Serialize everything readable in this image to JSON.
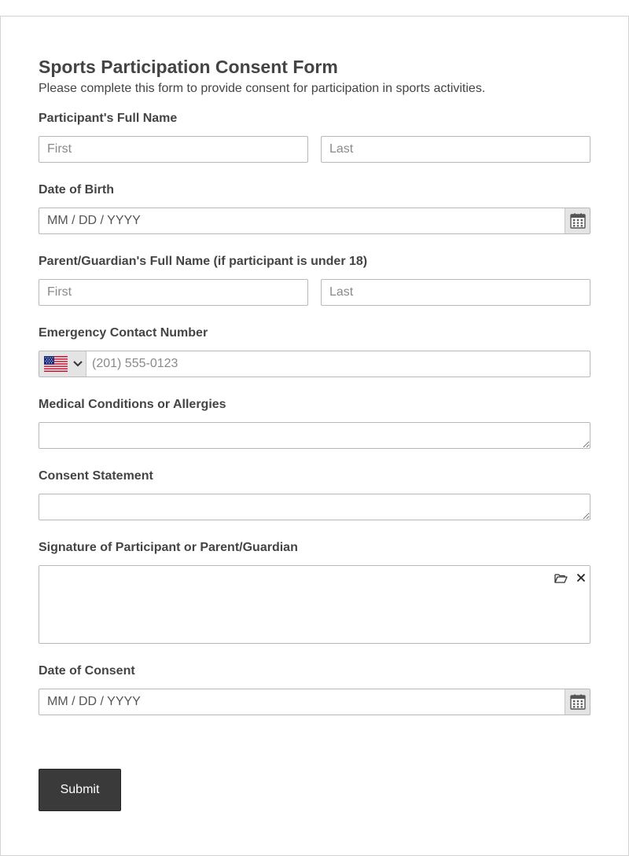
{
  "form": {
    "title": "Sports Participation Consent Form",
    "subtitle": "Please complete this form to provide consent for participation in sports activities."
  },
  "participant_name": {
    "label": "Participant's Full Name",
    "first_placeholder": "First",
    "last_placeholder": "Last"
  },
  "date_of_birth": {
    "label": "Date of Birth",
    "placeholder": "MM / DD / YYYY",
    "icon": "calendar-icon"
  },
  "guardian_name": {
    "label": "Parent/Guardian's Full Name (if participant is under 18)",
    "first_placeholder": "First",
    "last_placeholder": "Last"
  },
  "emergency_contact": {
    "label": "Emergency Contact Number",
    "country_icon": "us-flag-icon",
    "placeholder": "(201) 555-0123"
  },
  "medical_conditions": {
    "label": "Medical Conditions or Allergies"
  },
  "consent_statement": {
    "label": "Consent Statement"
  },
  "signature": {
    "label": "Signature of Participant or Parent/Guardian",
    "upload_icon": "folder-open-icon",
    "clear_icon": "close-icon"
  },
  "date_of_consent": {
    "label": "Date of Consent",
    "placeholder": "MM / DD / YYYY",
    "icon": "calendar-icon"
  },
  "submit_label": "Submit",
  "colors": {
    "text": "#444444",
    "border": "#b8b8b8",
    "addon_bg": "#e4e4e4",
    "button_bg": "#3a3a3a"
  }
}
